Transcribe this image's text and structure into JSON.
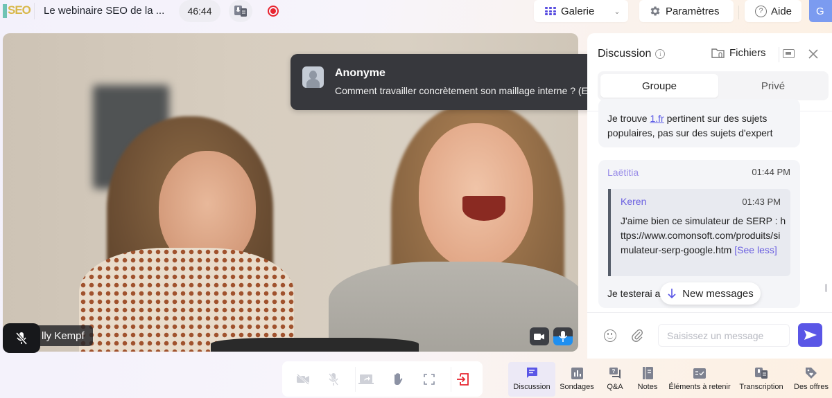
{
  "app": {
    "logo_text": "SEO",
    "webinar_title": "Le webinaire SEO de la ...",
    "timer": "46:44",
    "recording": true
  },
  "toolbar": {
    "layout_label": "Galerie",
    "settings_label": "Paramètres",
    "help_label": "Aide",
    "user_initial": "G"
  },
  "video": {
    "speaker_name": "lly Kempf",
    "self_mic_muted": true,
    "speaker_camera_on": true,
    "speaker_mic_active": true
  },
  "toast": {
    "author": "Anonyme",
    "message": "Comment travailler concrètement son maillage interne ? (Emma)"
  },
  "chat": {
    "title": "Discussion",
    "files_label": "Fichiers",
    "tabs": [
      {
        "label": "Groupe",
        "active": true
      },
      {
        "label": "Privé",
        "active": false
      }
    ],
    "messages": [
      {
        "text_before_link": "Je trouve ",
        "link": "1.fr",
        "text_after_link": " pertinent sur des sujets populaires, pas sur des sujets d'expert"
      },
      {
        "author": "Laëtitia",
        "time": "01:44 PM",
        "quote": {
          "author": "Keren",
          "time": "01:43 PM",
          "text": "J'aime bien ce simulateur de SERP : https://www.comonsoft.com/produits/simulateur-serp-google.htm",
          "toggle": "[See less]"
        },
        "text": "Je testerai a"
      }
    ],
    "new_messages_label": "New messages",
    "input_placeholder": "Saisissez un message",
    "input_value": ""
  },
  "controls": [
    {
      "name": "camera-off",
      "label": "Caméra désactivée"
    },
    {
      "name": "mic-off",
      "label": "Micro désactivé"
    },
    {
      "name": "share-screen",
      "label": "Partager l'écran"
    },
    {
      "name": "raise-hand",
      "label": "Lever la main"
    },
    {
      "name": "fullscreen",
      "label": "Plein écran"
    },
    {
      "name": "leave",
      "label": "Quitter"
    }
  ],
  "bottom_tabs": [
    {
      "label": "Discussion",
      "active": true
    },
    {
      "label": "Sondages",
      "active": false
    },
    {
      "label": "Q&A",
      "active": false
    },
    {
      "label": "Notes",
      "active": false
    },
    {
      "label": "Éléments à retenir",
      "active": false
    },
    {
      "label": "Transcription",
      "active": false
    },
    {
      "label": "Des offres",
      "active": false
    }
  ],
  "colors": {
    "accent": "#5a56e6",
    "record": "#e8242f",
    "toast_bg": "#37383d",
    "mic_active": "#1f8ff0",
    "avatar_bg": "#7b9bf0"
  }
}
